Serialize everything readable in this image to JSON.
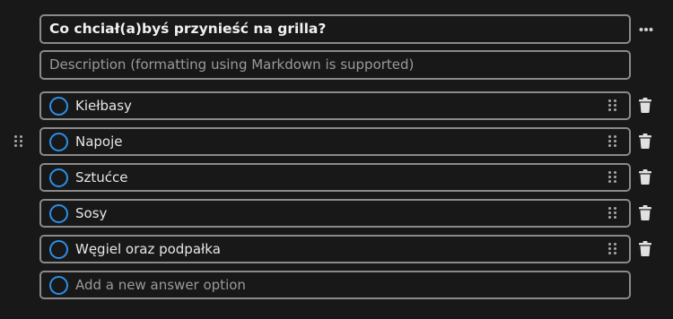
{
  "question": {
    "title": "Co chciał(a)byś przynieść na grilla?",
    "description_placeholder": "Description (formatting using Markdown is supported)"
  },
  "options": [
    {
      "label": "Kiełbasy"
    },
    {
      "label": "Napoje"
    },
    {
      "label": "Sztućce"
    },
    {
      "label": "Sosy"
    },
    {
      "label": "Węgiel oraz podpałka"
    }
  ],
  "new_option": {
    "placeholder": "Add a new answer option"
  },
  "icons": {
    "more": "more-horizontal-icon",
    "drag": "drag-handle-icon",
    "delete": "trash-icon",
    "radio": "radio-circle-icon"
  },
  "colors": {
    "background": "#181818",
    "border": "#8a8a8a",
    "accent": "#2b8fe6",
    "text": "#e6e6e6",
    "placeholder": "#9a9a9a"
  }
}
